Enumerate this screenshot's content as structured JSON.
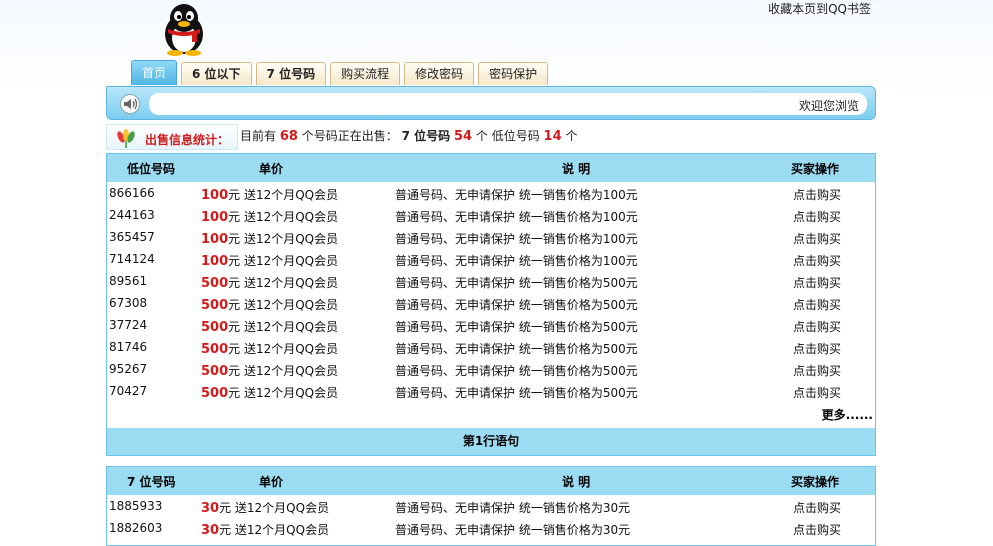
{
  "header": {
    "bookmark_link": "收藏本页到QQ书签"
  },
  "tabs": [
    {
      "label": "首页"
    },
    {
      "label": "6 位以下"
    },
    {
      "label": "7 位号码"
    },
    {
      "label": "购买流程"
    },
    {
      "label": "修改密码"
    },
    {
      "label": "密码保护"
    }
  ],
  "notice": {
    "welcome": "欢迎您浏览"
  },
  "stats": {
    "label": "出售信息统计：",
    "prefix": "目前有",
    "total": "68",
    "middle": "个号码正在出售：",
    "seven_label": "7 位号码",
    "seven_count": "54",
    "low_prefix": "个 低位号码",
    "low_count": "14",
    "suffix": "个"
  },
  "table1": {
    "headers": [
      "低位号码",
      "单价",
      "说  明",
      "买家操作"
    ],
    "rows": [
      {
        "number": "866166",
        "price": "100",
        "unit": "元 送12个月QQ会员",
        "desc": "普通号码、无申请保护 统一销售价格为100元",
        "action": "点击购买"
      },
      {
        "number": "244163",
        "price": "100",
        "unit": "元 送12个月QQ会员",
        "desc": "普通号码、无申请保护 统一销售价格为100元",
        "action": "点击购买"
      },
      {
        "number": "365457",
        "price": "100",
        "unit": "元 送12个月QQ会员",
        "desc": "普通号码、无申请保护 统一销售价格为100元",
        "action": "点击购买"
      },
      {
        "number": "714124",
        "price": "100",
        "unit": "元 送12个月QQ会员",
        "desc": "普通号码、无申请保护 统一销售价格为100元",
        "action": "点击购买"
      },
      {
        "number": "89561",
        "price": "500",
        "unit": "元 送12个月QQ会员",
        "desc": "普通号码、无申请保护 统一销售价格为500元",
        "action": "点击购买"
      },
      {
        "number": "67308",
        "price": "500",
        "unit": "元 送12个月QQ会员",
        "desc": "普通号码、无申请保护 统一销售价格为500元",
        "action": "点击购买"
      },
      {
        "number": "37724",
        "price": "500",
        "unit": "元 送12个月QQ会员",
        "desc": "普通号码、无申请保护 统一销售价格为500元",
        "action": "点击购买"
      },
      {
        "number": "81746",
        "price": "500",
        "unit": "元 送12个月QQ会员",
        "desc": "普通号码、无申请保护 统一销售价格为500元",
        "action": "点击购买"
      },
      {
        "number": "95267",
        "price": "500",
        "unit": "元 送12个月QQ会员",
        "desc": "普通号码、无申请保护 统一销售价格为500元",
        "action": "点击购买"
      },
      {
        "number": "70427",
        "price": "500",
        "unit": "元 送12个月QQ会员",
        "desc": "普通号码、无申请保护 统一销售价格为500元",
        "action": "点击购买"
      }
    ],
    "more": "更多......",
    "footer": "第1行语句"
  },
  "table2": {
    "headers": [
      "7 位号码",
      "单价",
      "说  明",
      "买家操作"
    ],
    "rows": [
      {
        "number": "1885933",
        "price": "30",
        "unit": "元 送12个月QQ会员",
        "desc": "普通号码、无申请保护 统一销售价格为30元",
        "action": "点击购买"
      },
      {
        "number": "1882603",
        "price": "30",
        "unit": "元 送12个月QQ会员",
        "desc": "普通号码、无申请保护 统一销售价格为30元",
        "action": "点击购买"
      }
    ]
  },
  "colors": {
    "accent_blue": "#9cdcf3",
    "price_red": "#d31a1a",
    "tab_active": "#4fb6e6"
  },
  "icons": [
    "qq-penguin-logo",
    "speaker-icon",
    "flower-icon"
  ]
}
